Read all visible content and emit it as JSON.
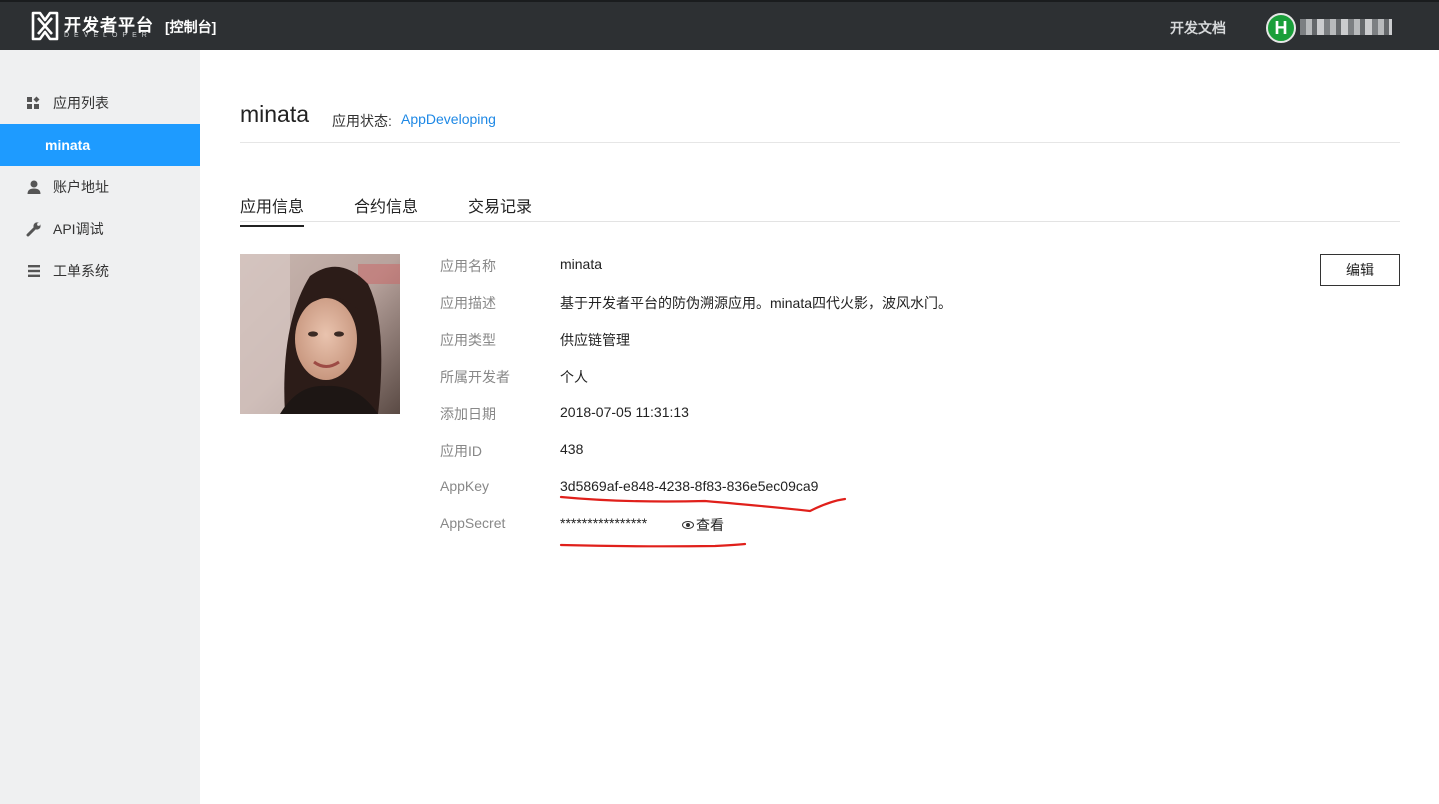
{
  "header": {
    "brand_title": "开发者平台",
    "brand_sub": "DEVELOPER",
    "console": "[控制台]",
    "docs": "开发文档",
    "avatar_letter": "H"
  },
  "sidebar": {
    "items": [
      {
        "label": "应用列表",
        "icon": "grid-icon"
      },
      {
        "label": "minata",
        "icon": ""
      },
      {
        "label": "账户地址",
        "icon": "user-icon"
      },
      {
        "label": "API调试",
        "icon": "wrench-icon"
      },
      {
        "label": "工单系统",
        "icon": "list-icon"
      }
    ]
  },
  "app": {
    "title": "minata",
    "status_label": "应用状态:",
    "status_value": "AppDeveloping"
  },
  "tabs": [
    "应用信息",
    "合约信息",
    "交易记录"
  ],
  "details": {
    "rows": [
      {
        "label": "应用名称",
        "value": "minata"
      },
      {
        "label": "应用描述",
        "value": "基于开发者平台的防伪溯源应用。minata四代火影，波风水门。"
      },
      {
        "label": "应用类型",
        "value": "供应链管理"
      },
      {
        "label": "所属开发者",
        "value": "个人"
      },
      {
        "label": "添加日期",
        "value": "2018-07-05 11:31:13"
      },
      {
        "label": "应用ID",
        "value": "438"
      },
      {
        "label": "AppKey",
        "value": "3d5869af-e848-4238-8f83-836e5ec09ca9"
      },
      {
        "label": "AppSecret",
        "value": "****************"
      }
    ],
    "view_label": "查看",
    "edit_label": "编辑"
  },
  "colors": {
    "topbar": "#2d3033",
    "sidebar_bg": "#eff0f1",
    "accent": "#1e9bff",
    "status_link": "#1e88e5",
    "annotation_red": "#e0201b"
  }
}
